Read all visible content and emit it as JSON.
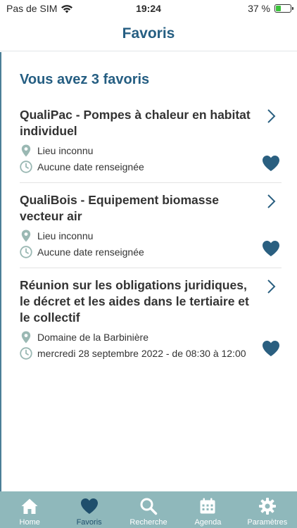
{
  "status_bar": {
    "carrier": "Pas de SIM",
    "time": "19:24",
    "battery_text": "37 %",
    "battery_level": 0.37
  },
  "header": {
    "title": "Favoris"
  },
  "summary": {
    "count_title": "Vous avez 3 favoris"
  },
  "favorites": [
    {
      "title": "QualiPac - Pompes à chaleur en habitat individuel",
      "location": "Lieu inconnu",
      "date": "Aucune date renseignée"
    },
    {
      "title": "QualiBois - Equipement biomasse vecteur air",
      "location": "Lieu inconnu",
      "date": "Aucune date renseignée"
    },
    {
      "title": "Réunion sur les obligations juridiques, le décret et les aides dans le tertiaire et le collectif",
      "location": "Domaine de la Barbinière",
      "date": "mercredi 28 septembre 2022 - de 08:30 à 12:00"
    }
  ],
  "tabs": [
    {
      "label": "Home",
      "icon": "home-icon"
    },
    {
      "label": "Favoris",
      "icon": "heart-icon",
      "active": true
    },
    {
      "label": "Recherche",
      "icon": "search-icon"
    },
    {
      "label": "Agenda",
      "icon": "calendar-icon"
    },
    {
      "label": "Paramètres",
      "icon": "gear-icon"
    }
  ],
  "colors": {
    "accent": "#255e82",
    "heart": "#2a5f80",
    "meta_icon": "#9ab8b3",
    "tab_bar": "#8fb8bb",
    "tab_active": "#1f4f6c"
  }
}
